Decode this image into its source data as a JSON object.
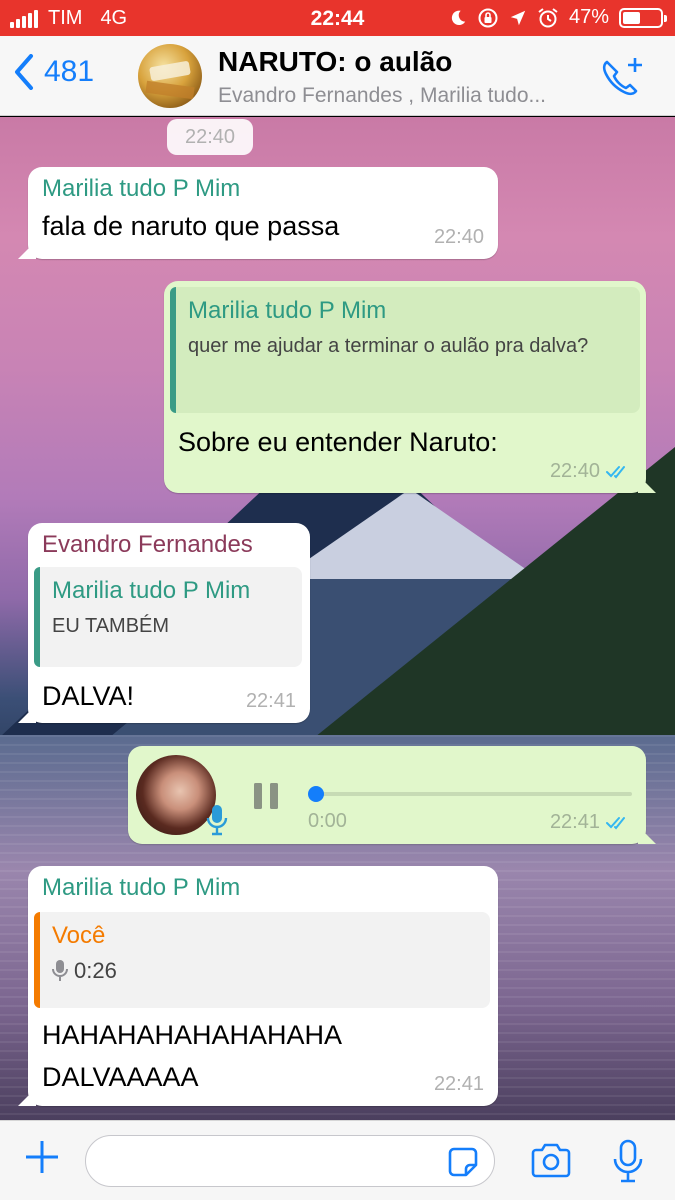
{
  "status_bar": {
    "carrier": "TIM",
    "network": "4G",
    "time": "22:44",
    "battery": "47%",
    "battery_level": 0.47,
    "icons": [
      "moon-icon",
      "orientation-lock-icon",
      "location-icon",
      "alarm-icon"
    ]
  },
  "header": {
    "back_count": "481",
    "title": "NARUTO: o aulão",
    "subtitle": "Evandro Fernandes , Marilia tudo...",
    "accent": "#147efb"
  },
  "chat": {
    "top_time": "22:40",
    "messages": [
      {
        "sender": "Marilia tudo P Mim",
        "text": "fala de naruto que passa",
        "time": "22:40"
      },
      {
        "quote_sender": "Marilia tudo P Mim",
        "quote_text": "quer me ajudar a terminar o aulão pra dalva?",
        "text": "Sobre eu entender Naruto:",
        "time": "22:40"
      },
      {
        "sender": "Evandro Fernandes",
        "quote_sender": "Marilia tudo P Mim",
        "quote_text": "EU TAMBÉM",
        "text": "DALVA!",
        "time": "22:41"
      },
      {
        "voice_elapsed": "0:00",
        "time": "22:41",
        "progress": 0
      },
      {
        "sender": "Marilia tudo P Mim",
        "quote_sender": "Você",
        "quote_duration": "0:26",
        "text_line1": "HAHAHAHAHAHAHAHA",
        "text_line2": "DALVAAAAA",
        "time": "22:41"
      }
    ]
  },
  "colors": {
    "status_bar": "#e8342c",
    "outgoing_bubble": "#e1f7cb",
    "sender_green": "#2e9a83",
    "sender_evandro": "#8b3a5a",
    "quote_orange": "#f47b00",
    "read_ticks": "#34b7f1"
  },
  "input": {
    "placeholder": ""
  }
}
